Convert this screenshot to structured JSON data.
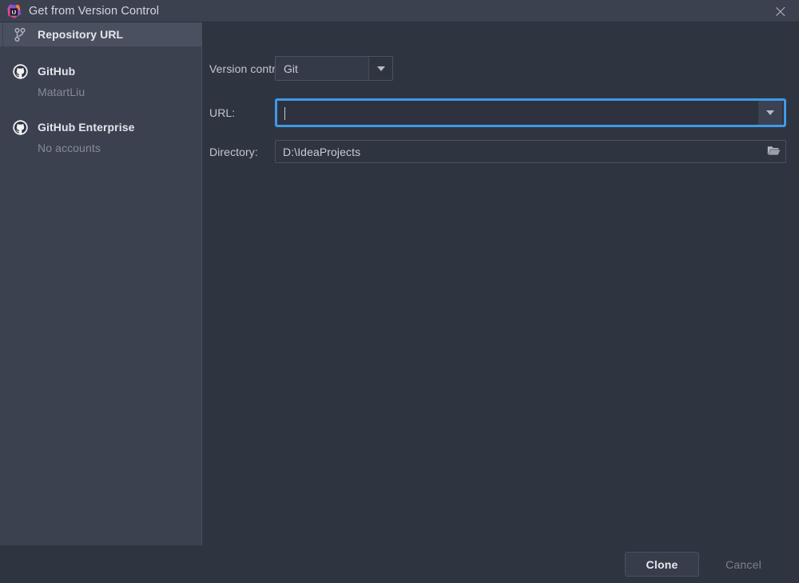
{
  "window": {
    "title": "Get from Version Control",
    "app_icon": "intellij-idea-logo",
    "close_icon": "close-icon"
  },
  "sidebar": {
    "items": [
      {
        "label": "Repository URL",
        "icon": "git-branch-icon",
        "selected": true,
        "sublabel": null
      },
      {
        "label": "GitHub",
        "icon": "github-icon",
        "selected": false,
        "sublabel": "MatartLiu"
      },
      {
        "label": "GitHub Enterprise",
        "icon": "github-icon",
        "selected": false,
        "sublabel": "No accounts"
      }
    ]
  },
  "form": {
    "version_control": {
      "label": "Version control:",
      "value": "Git",
      "options": [
        "Git"
      ],
      "arrow_icon": "chevron-down-icon"
    },
    "url": {
      "label": "URL:",
      "value": "",
      "placeholder": "",
      "focused": true,
      "arrow_icon": "chevron-down-icon"
    },
    "directory": {
      "label": "Directory:",
      "value": "D:\\IdeaProjects",
      "browse_icon": "folder-icon"
    }
  },
  "footer": {
    "clone_label": "Clone",
    "cancel_label": "Cancel"
  },
  "colors": {
    "titlebar_bg": "#3c4150",
    "sidebar_bg": "#3c4150",
    "sidebar_selected": "#4b5060",
    "main_bg": "#2f3441",
    "focus_ring": "#3e9ae8",
    "text_primary": "#c9ccd3",
    "text_muted": "#868b96"
  }
}
